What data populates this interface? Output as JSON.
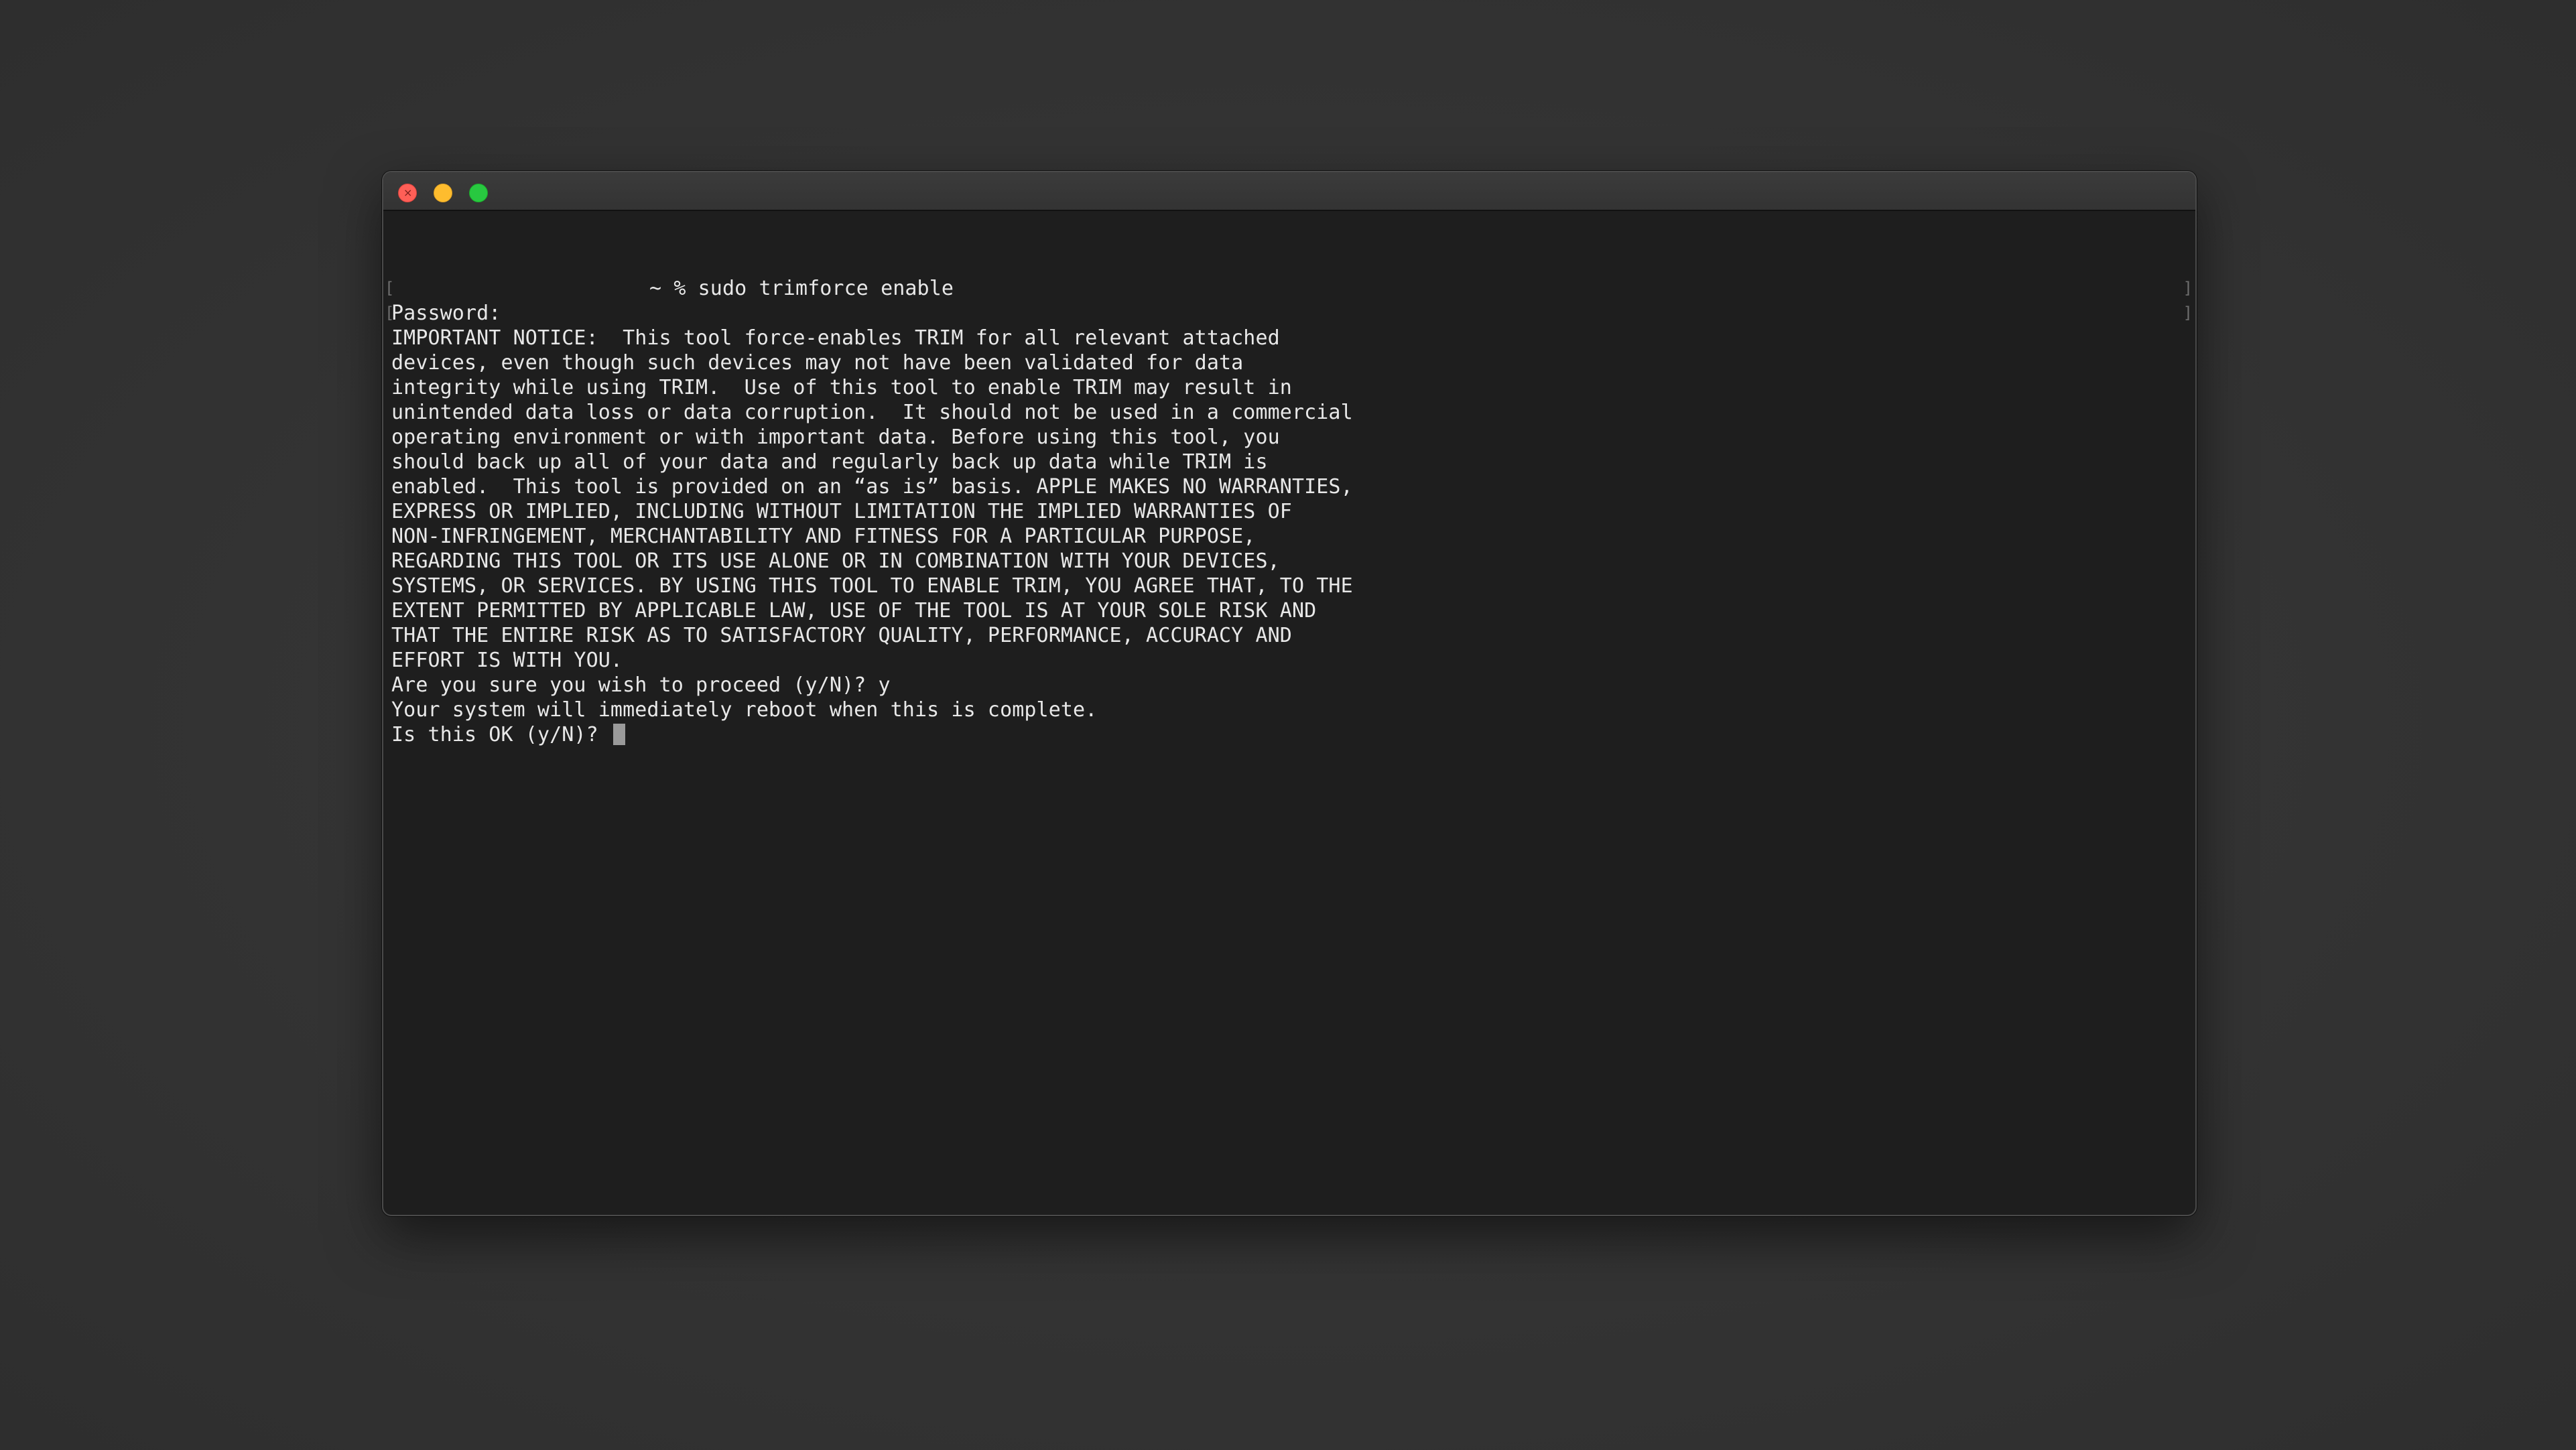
{
  "window": {
    "controls": {
      "close_icon": "close-icon",
      "minimize_icon": "minimize-icon",
      "zoom_icon": "zoom-icon"
    }
  },
  "terminal": {
    "prompt": "~ % sudo trimforce enable",
    "password_prompt": "Password:",
    "notice_lines": [
      "IMPORTANT NOTICE:  This tool force-enables TRIM for all relevant attached",
      "devices, even though such devices may not have been validated for data",
      "integrity while using TRIM.  Use of this tool to enable TRIM may result in",
      "unintended data loss or data corruption.  It should not be used in a commercial",
      "operating environment or with important data. Before using this tool, you",
      "should back up all of your data and regularly back up data while TRIM is",
      "enabled.  This tool is provided on an “as is” basis. APPLE MAKES NO WARRANTIES,",
      "EXPRESS OR IMPLIED, INCLUDING WITHOUT LIMITATION THE IMPLIED WARRANTIES OF",
      "NON-INFRINGEMENT, MERCHANTABILITY AND FITNESS FOR A PARTICULAR PURPOSE,",
      "REGARDING THIS TOOL OR ITS USE ALONE OR IN COMBINATION WITH YOUR DEVICES,",
      "SYSTEMS, OR SERVICES. BY USING THIS TOOL TO ENABLE TRIM, YOU AGREE THAT, TO THE",
      "EXTENT PERMITTED BY APPLICABLE LAW, USE OF THE TOOL IS AT YOUR SOLE RISK AND",
      "THAT THE ENTIRE RISK AS TO SATISFACTORY QUALITY, PERFORMANCE, ACCURACY AND",
      "EFFORT IS WITH YOU."
    ],
    "confirm_line": "Are you sure you wish to proceed (y/N)? y",
    "reboot_line": "Your system will immediately reboot when this is complete.",
    "final_prompt": "Is this OK (y/N)? "
  },
  "colors": {
    "background": "#2e2e2e",
    "terminal_bg": "#1e1e1e",
    "text": "#e8e8e8",
    "close": "#ff5f57",
    "minimize": "#febc2e",
    "zoom": "#28c840"
  }
}
